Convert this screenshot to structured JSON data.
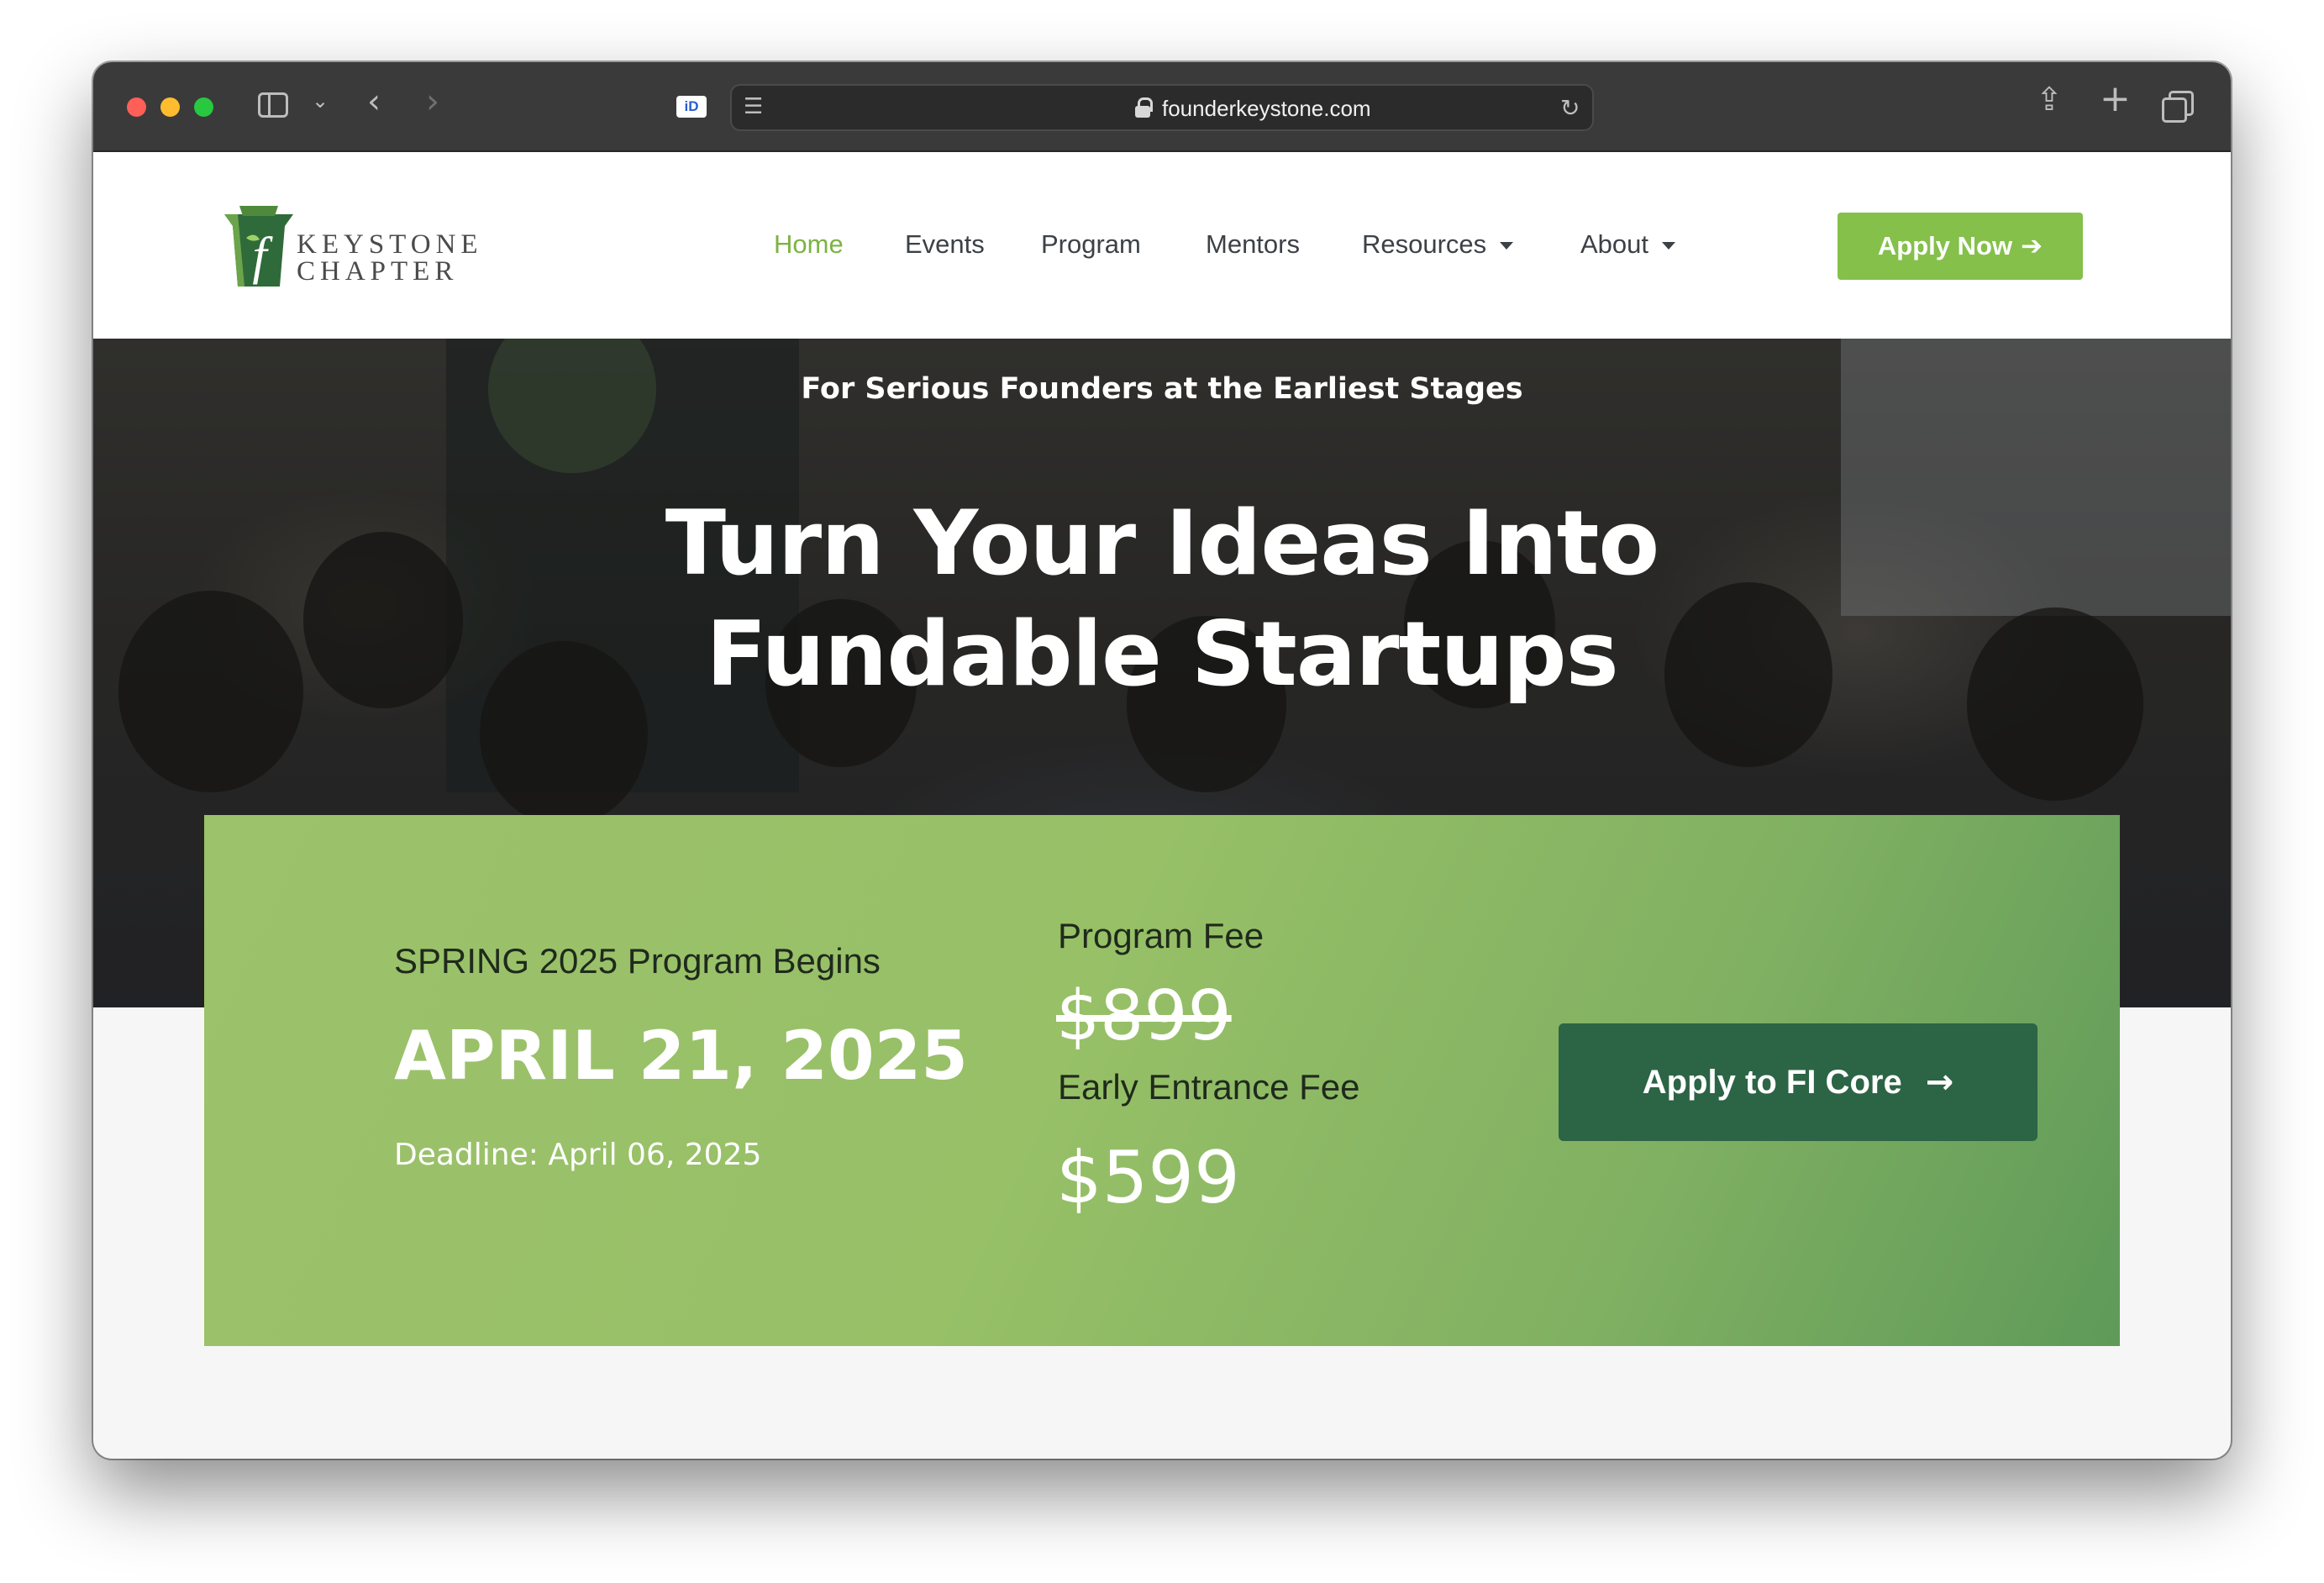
{
  "browser": {
    "url": "founderkeystone.com"
  },
  "logo": {
    "line1": "KEYSTONE",
    "line2": "CHAPTER"
  },
  "nav": {
    "items": [
      {
        "label": "Home",
        "active": true
      },
      {
        "label": "Events"
      },
      {
        "label": "Program"
      },
      {
        "label": "Mentors"
      },
      {
        "label": "Resources",
        "dropdown": true
      },
      {
        "label": "About",
        "dropdown": true
      }
    ],
    "cta": "Apply Now"
  },
  "hero": {
    "tagline": "For Serious Founders at the Earliest Stages",
    "title_line1": "Turn Your Ideas Into",
    "title_line2": "Fundable Startups"
  },
  "program": {
    "begins": "SPRING 2025 Program Begins",
    "date": "APRIL 21, 2025",
    "deadline": "Deadline: April 06, 2025",
    "fee_label": "Program Fee",
    "fee_old": "$899",
    "early_label": "Early Entrance Fee",
    "fee_new": "$599",
    "cta": "Apply to FI Core"
  },
  "colors": {
    "accent_green": "#84c04a",
    "active_nav": "#7cb342",
    "dark_green_button": "#2c6446",
    "card_green": "#9cc26b"
  },
  "icons": {
    "cta_arrow": "arrow-right-icon",
    "dropdown": "caret-down-icon"
  }
}
